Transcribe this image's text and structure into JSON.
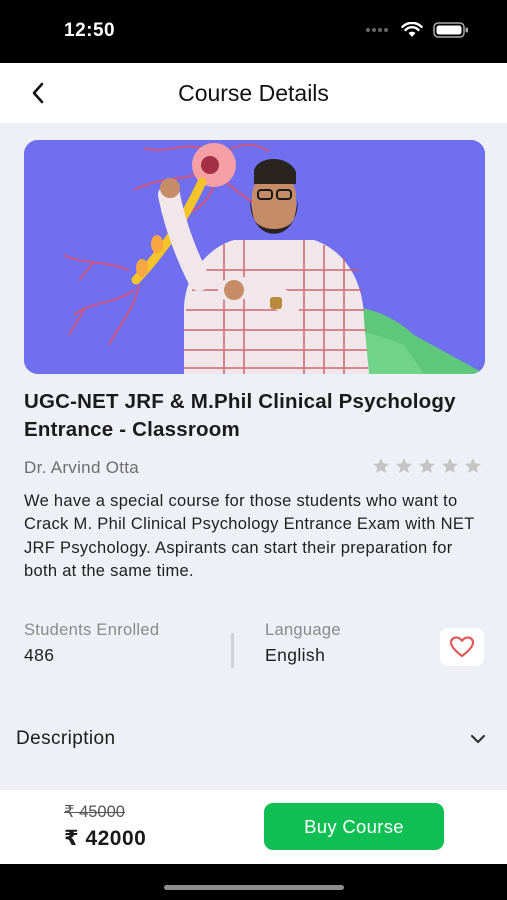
{
  "status_bar": {
    "time": "12:50"
  },
  "header": {
    "title": "Course Details"
  },
  "course": {
    "title": "UGC-NET JRF & M.Phil Clinical Psychology Entrance - Classroom",
    "instructor": "Dr. Arvind Otta",
    "rating": 0,
    "rating_max": 5,
    "description": "We have a special course for those students who want to Crack M. Phil Clinical Psychology Entrance Exam with NET JRF Psychology. Aspirants can start their preparation for both at the same time.",
    "stats": {
      "students_label": "Students Enrolled",
      "students_value": "486",
      "language_label": "Language",
      "language_value": "English"
    }
  },
  "sections": {
    "description_label": "Description"
  },
  "purchase": {
    "old_price": "₹ 45000",
    "new_price": "₹ 42000",
    "buy_label": "Buy Course"
  },
  "colors": {
    "accent": "#0fbf53",
    "hero_bg": "#6f6ff0",
    "favorite": "#e05a5a",
    "star_inactive": "#c4c4c4"
  },
  "icons": {
    "back": "chevron-left-icon",
    "favorite": "heart-outline-icon",
    "expand": "chevron-down-icon",
    "wifi": "wifi-icon",
    "battery": "battery-icon",
    "signal": "cellular-signal-icon",
    "star": "star-icon"
  }
}
